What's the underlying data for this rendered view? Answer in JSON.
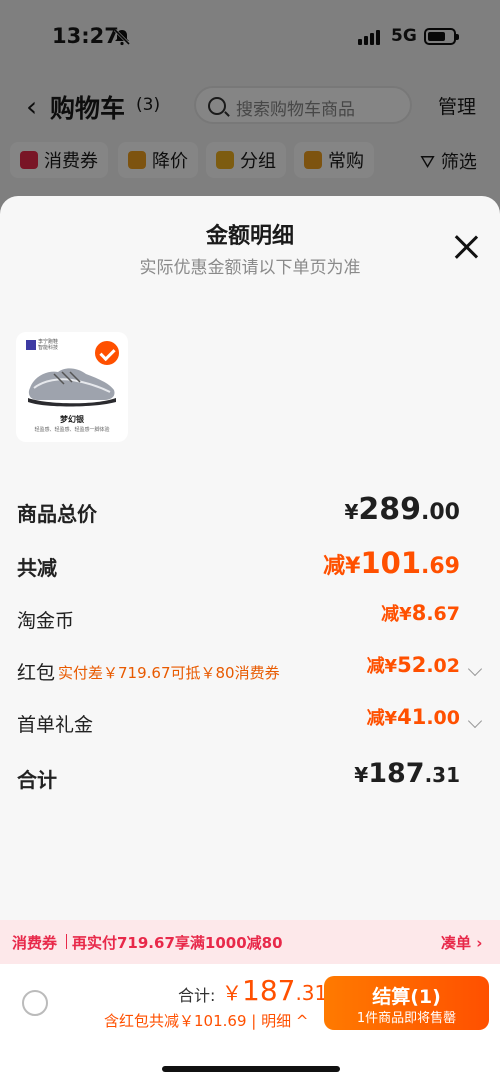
{
  "status_bar": {
    "time": "13:27",
    "network": "5G"
  },
  "header": {
    "back": "‹",
    "title": "购物车",
    "count": "(3)",
    "search_placeholder": "搜索购物车商品",
    "manage": "管理"
  },
  "chips": [
    {
      "label": "消费券",
      "color": "#e8294a"
    },
    {
      "label": "降价",
      "color": "#f0a020"
    },
    {
      "label": "分组",
      "color": "#f0b020"
    },
    {
      "label": "常购",
      "color": "#f0a020"
    }
  ],
  "filter": "筛选",
  "sheet": {
    "title": "金额明细",
    "subtitle": "实际优惠金额请以下单页为准",
    "product": {
      "badge_text": "李宁跑鞋 智能科技",
      "name": "梦幻银",
      "desc": "轻盈感、轻盈感、轻盈感一脚体验"
    },
    "rows": {
      "total_price": {
        "label": "商品总价",
        "pre": "¥",
        "int": "289",
        "dec": ".00"
      },
      "discount": {
        "label": "共减",
        "pre": "减¥",
        "int": "101",
        "dec": ".69"
      },
      "coins": {
        "label": "淘金币",
        "pre": "减¥",
        "int": "8",
        "dec": ".67"
      },
      "redpacket": {
        "label": "红包",
        "note": "实付差￥719.67可抵￥80消费券",
        "pre": "减¥",
        "int": "52",
        "dec": ".02"
      },
      "first_order": {
        "label": "首单礼金",
        "pre": "减¥",
        "int": "41",
        "dec": ".00"
      },
      "sum": {
        "label": "合计",
        "pre": "¥",
        "int": "187",
        "dec": ".31"
      }
    }
  },
  "coupon_bar": {
    "tag": "消费券",
    "text": "再实付719.67享满1000减80",
    "link": "凑单 ›"
  },
  "checkout": {
    "total_label": "合计:",
    "total_pre": "￥",
    "total_int": "187",
    "total_dec": ".31",
    "sub": "含红包共减￥101.69 | 明细 ^",
    "pay_label": "结算(1)",
    "pay_sub": "1件商品即将售罄"
  },
  "colors": {
    "accent": "#ff5000",
    "coupon": "#e8294a"
  }
}
